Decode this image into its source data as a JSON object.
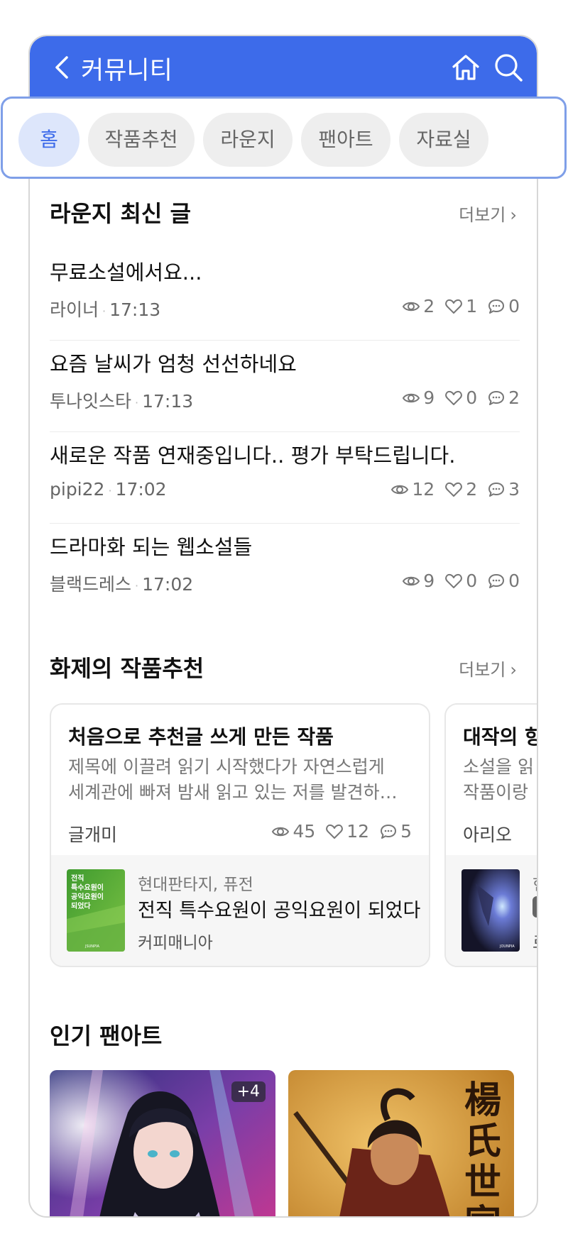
{
  "header": {
    "title": "커뮤니티"
  },
  "tabs": [
    {
      "label": "홈",
      "active": true
    },
    {
      "label": "작품추천",
      "active": false
    },
    {
      "label": "라운지",
      "active": false
    },
    {
      "label": "팬아트",
      "active": false
    },
    {
      "label": "자료실",
      "active": false
    }
  ],
  "lounge": {
    "title": "라운지 최신 글",
    "more": "더보기",
    "posts": [
      {
        "title": "무료소설에서요...",
        "author": "라이너",
        "time": "17:13",
        "views": "2",
        "likes": "1",
        "comments": "0"
      },
      {
        "title": "요즘 날씨가 엄청 선선하네요",
        "author": "투나잇스타",
        "time": "17:13",
        "views": "9",
        "likes": "0",
        "comments": "2"
      },
      {
        "title": "새로운 작품 연재중입니다.. 평가 부탁드립니다.",
        "author": "pipi22",
        "time": "17:02",
        "views": "12",
        "likes": "2",
        "comments": "3"
      },
      {
        "title": "드라마화 되는 웹소설들",
        "author": "블랙드레스",
        "time": "17:02",
        "views": "9",
        "likes": "0",
        "comments": "0"
      }
    ]
  },
  "recommend": {
    "title": "화제의 작품추천",
    "more": "더보기",
    "cards": [
      {
        "title": "처음으로 추천글 쓰게 만든 작품",
        "desc1": "제목에 이끌려 읽기 시작했다가 자연스럽게",
        "desc2": "세계관에 빠져 밤새 읽고 있는 저를 발견하…",
        "author": "글개미",
        "views": "45",
        "likes": "12",
        "comments": "5",
        "book": {
          "genre": "현대판타지, 퓨전",
          "title": "전직 특수요원이 공익요원이 되었다",
          "author": "커피매니아",
          "cover_text": "전직 특수요원이 공익요원이 되었다",
          "cover_brand": "JSUNPIA"
        }
      },
      {
        "title": "대작의 향",
        "desc1": "소설을 읽",
        "desc2": "작품이랑",
        "author": "아리오",
        "book": {
          "genre": "현",
          "title": "",
          "author": "르",
          "cover_brand": "JOUNPIA"
        }
      }
    ]
  },
  "fanart": {
    "title": "인기 팬아트",
    "items": [
      {
        "badge": "+4"
      },
      {
        "calligraphy": "楊氏世家伝"
      }
    ]
  },
  "colors": {
    "primary": "#3d6bea",
    "tab_active_bg": "#dde6fb",
    "tab_bg": "#eeeeee"
  }
}
